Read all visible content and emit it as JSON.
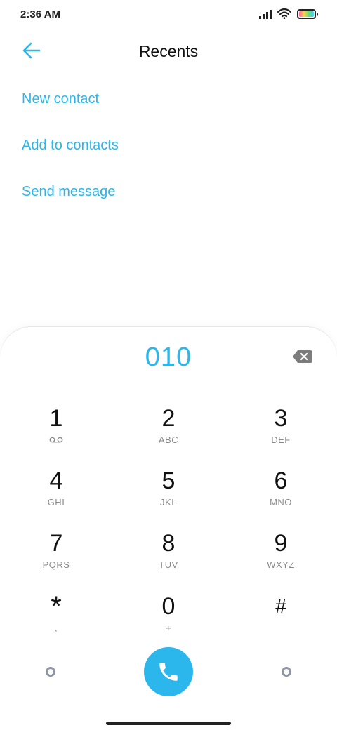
{
  "status_bar": {
    "time": "2:36 AM"
  },
  "header": {
    "title": "Recents"
  },
  "actions": [
    {
      "label": "New contact"
    },
    {
      "label": "Add to contacts"
    },
    {
      "label": "Send message"
    }
  ],
  "dialer": {
    "number": "010",
    "keys": [
      {
        "digit": "1",
        "letters": ""
      },
      {
        "digit": "2",
        "letters": "ABC"
      },
      {
        "digit": "3",
        "letters": "DEF"
      },
      {
        "digit": "4",
        "letters": "GHI"
      },
      {
        "digit": "5",
        "letters": "JKL"
      },
      {
        "digit": "6",
        "letters": "MNO"
      },
      {
        "digit": "7",
        "letters": "PQRS"
      },
      {
        "digit": "8",
        "letters": "TUV"
      },
      {
        "digit": "9",
        "letters": "WXYZ"
      },
      {
        "digit": "*",
        "letters": ","
      },
      {
        "digit": "0",
        "letters": "+"
      },
      {
        "digit": "#",
        "letters": ""
      }
    ]
  },
  "colors": {
    "accent": "#2bb6ec"
  },
  "icons": [
    "back-arrow-icon",
    "backspace-icon",
    "voicemail-icon",
    "phone-icon",
    "signal-icon",
    "wifi-icon",
    "battery-icon"
  ]
}
